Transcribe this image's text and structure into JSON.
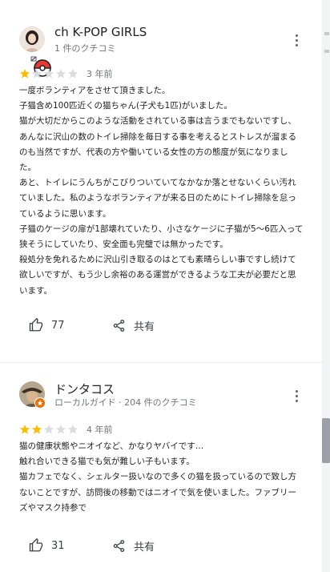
{
  "reviews": [
    {
      "author": "ch K-POP GIRLS",
      "subtitle": "1 件のクチコミ",
      "rating": 1,
      "max_rating": 5,
      "date": "3 年前",
      "lines": [
        "一度ボランティアをさせて頂きました。",
        "子猫含め100匹近くの猫ちゃん(子犬も1匹)がいました。",
        "猫が大切だからこのような活動をされている事は言うまでもないですし、",
        "あんなに沢山の数のトイレ掃除を毎日する事を考えるとストレスが溜まる",
        "のも当然ですが、代表の方や働いている女性の方の態度が気になりまし",
        "た。",
        "あと、トイレにうんちがこびりついていてなかなか落とせないくらい汚れ",
        "ていました。私のようなボランティアが来る日のためにトイレ掃除を怠っ",
        "ているように思います。",
        "子猫のケージの扉が1部壊れていたり、小さなケージに子猫が5〜6匹入って",
        "狭そうにしていたり、安全面も完璧では無かったです。",
        "殺処分を免れるために沢山引き取るのはとても素晴らしい事ですし続けて",
        "欲しいですが、もう少し余裕のある運営ができるような工夫が必要だと思",
        "います。"
      ],
      "likes": "77",
      "share_label": "共有"
    },
    {
      "author": "ドンタコス",
      "subtitle": "ローカルガイド · 204 件のクチコミ",
      "rating": 2,
      "max_rating": 5,
      "date": "4 年前",
      "lines": [
        "猫の健康状態やニオイなど、かなりヤバイです…",
        "触れ合いできる猫でも気が難しい子もいます。",
        "猫カフェでなく、シェルター扱いなので多くの猫を扱っているので致し方",
        "ないことですが、訪問後の移動ではニオイで気を使いました。ファブリー",
        "ズやマスク持参で"
      ],
      "likes": "31",
      "share_label": "共有"
    }
  ],
  "colors": {
    "star_filled": "#fbbc04",
    "star_empty": "#dadce0",
    "local_guide_badge": "#e8710a"
  },
  "icons": [
    "more-vert-icon",
    "thumb-up-icon",
    "share-icon",
    "star-icon"
  ]
}
